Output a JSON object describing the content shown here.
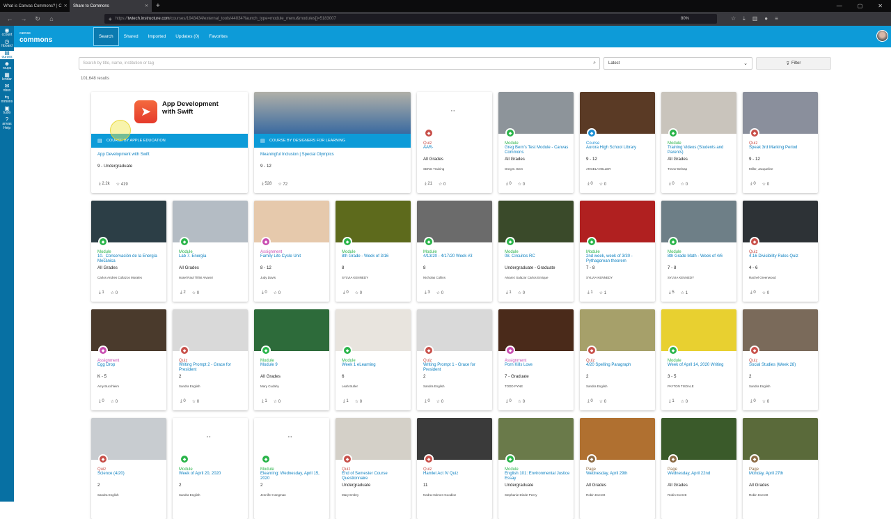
{
  "browser": {
    "tabs": [
      {
        "label": "What is Canvas Commons? | C"
      },
      {
        "label": "Share to Commons"
      }
    ],
    "url_prefix": "https://",
    "url_domain": "twtech.instructure.com",
    "url_rest": "/courses/1943434/external_tools/44034?launch_type=module_menu&modules[]=5183007",
    "zoom": "80%"
  },
  "sidebar": {
    "items": [
      {
        "label": "ccount"
      },
      {
        "label": "hboard"
      },
      {
        "label": "ourses"
      },
      {
        "label": "roups"
      },
      {
        "label": "lendar"
      },
      {
        "label": "nbox"
      },
      {
        "label": "mmons"
      },
      {
        "label": "tudio"
      },
      {
        "label": "anvas\nHelp"
      }
    ]
  },
  "header": {
    "logo_small": "canvas",
    "logo_large": "commons",
    "nav": [
      {
        "label": "Search"
      },
      {
        "label": "Shared"
      },
      {
        "label": "Imported"
      },
      {
        "label": "Updates (0)"
      },
      {
        "label": "Favorites"
      }
    ]
  },
  "search": {
    "placeholder": "Search by title, name, institution or tag"
  },
  "sort": {
    "value": "Latest"
  },
  "filter": {
    "label": "Filter"
  },
  "results": "101,648 results",
  "featured": [
    {
      "banner": "COURSE BY APPLE EDUCATION",
      "title": "App Development with Swift",
      "grade": "9 - Undergraduate",
      "downloads": "2.2k",
      "favorites": "419",
      "app_title": "App Development with Swift"
    },
    {
      "banner": "COURSE BY DESIGNERS FOR LEARNING",
      "title": "Meaningful Inclusion | Special Olympics",
      "grade": "9 - 12",
      "downloads": "528",
      "favorites": "72"
    }
  ],
  "cards": [
    {
      "type": "Quiz",
      "title": "AAR-",
      "grade": "All Grades",
      "author": "SDNG Training",
      "downloads": "21",
      "favorites": "0",
      "img": "loading"
    },
    {
      "type": "Module",
      "title": "Greg Bern's Test Module - Canvas Commons",
      "grade": "All Grades",
      "author": "Greg E. Bern",
      "downloads": "0",
      "favorites": "0",
      "img": "#8d949a"
    },
    {
      "type": "Course",
      "title": "Aurora High School Library",
      "grade": "9 - 12",
      "author": "ANGELA MILLER",
      "downloads": "0",
      "favorites": "0",
      "img": "#5a3a25"
    },
    {
      "type": "Module",
      "title": "Training Videos (Students and Parents)",
      "grade": "All Grades",
      "author": "Trevor Belnap",
      "downloads": "0",
      "favorites": "0",
      "img": "#c9c4bc"
    },
    {
      "type": "Quiz",
      "title": "Speak 3rd Marking Period",
      "grade": "9 - 12",
      "author": "Miller, Jacqueline",
      "downloads": "0",
      "favorites": "0",
      "img": "#8a8f9c"
    },
    {
      "type": "Module",
      "title": "10._Conservación de la Energía Mecánica",
      "grade": "All Grades",
      "author": "Carlos Andres Collazos Morales",
      "downloads": "1",
      "favorites": "0",
      "img": "#2c3e46"
    },
    {
      "type": "Module",
      "title": "Lab 7. Energía",
      "grade": "All Grades",
      "author": "Israel Raul Tiñini Alvarez",
      "downloads": "2",
      "favorites": "0",
      "img": "#b4bcc4"
    },
    {
      "type": "Assignment",
      "title": "Family Life Cycle Unit",
      "grade": "8 - 12",
      "author": "Judy Davis",
      "downloads": "0",
      "favorites": "0",
      "img": "#e6c9ac"
    },
    {
      "type": "Module",
      "title": "8th Grade - Week of 3/16",
      "grade": "8",
      "author": "SYLVIA KENNEDY",
      "downloads": "0",
      "favorites": "0",
      "img": "#5d6a1c"
    },
    {
      "type": "Module",
      "title": "4/13/20 - 4/17/20 Week #3",
      "grade": "8",
      "author": "Nicholas Collins",
      "downloads": "3",
      "favorites": "0",
      "img": "#6b6b6b"
    },
    {
      "type": "Module",
      "title": "08. Circuitos RC",
      "grade": "Undergraduate - Graduate",
      "author": "Alvarez Salazar Carlos Enrique",
      "downloads": "1",
      "favorites": "0",
      "img": "#3a4a2a"
    },
    {
      "type": "Module",
      "title": "2nd week, week of 3/30 - Pythagorean theorem",
      "grade": "7 - 8",
      "author": "SYLVIA KENNEDY",
      "downloads": "1",
      "favorites": "1",
      "img": "#b02020"
    },
    {
      "type": "Module",
      "title": "8th Grade Math - Week of 4/6",
      "grade": "7 - 8",
      "author": "SYLVIA KENNEDY",
      "downloads": "5",
      "favorites": "1",
      "img": "#6e7f87"
    },
    {
      "type": "Quiz",
      "title": "4.16 Divisibility Rules Quiz",
      "grade": "4 - 6",
      "author": "Rachel Greenwood",
      "downloads": "0",
      "favorites": "0",
      "img": "#2d3236"
    },
    {
      "type": "Assignment",
      "title": "Egg Drop",
      "grade": "K - 5",
      "author": "Amy Bucchleim",
      "downloads": "0",
      "favorites": "0",
      "img": "#4a3a2c"
    },
    {
      "type": "Quiz",
      "title": "Writing Prompt 2 - Grace for President",
      "grade": "2",
      "author": "Sandra English",
      "downloads": "0",
      "favorites": "0",
      "img": "#d9d9d9"
    },
    {
      "type": "Module",
      "title": "Module 9",
      "grade": "All Grades",
      "author": "Mary Cudahy",
      "downloads": "1",
      "favorites": "0",
      "img": "#2d6b3a"
    },
    {
      "type": "Module",
      "title": "Week 1 eLearning",
      "grade": "6",
      "author": "Leah Butler",
      "downloads": "1",
      "favorites": "0",
      "img": "#e8e4de"
    },
    {
      "type": "Quiz",
      "title": "Writing Prompt 1 - Grace for President",
      "grade": "2",
      "author": "Sandra English",
      "downloads": "0",
      "favorites": "0",
      "img": "#d9d9d9"
    },
    {
      "type": "Assignment",
      "title": "Porn Kills Love",
      "grade": "7 - Graduate",
      "author": "TODD PYNE",
      "downloads": "0",
      "favorites": "0",
      "img": "#4a2a1a"
    },
    {
      "type": "Quiz",
      "title": "4/20 Spelling Paragraph",
      "grade": "2",
      "author": "Sandra English",
      "downloads": "0",
      "favorites": "0",
      "img": "#a6a06a"
    },
    {
      "type": "Module",
      "title": "Week of April 14, 2020 Writing",
      "grade": "3 - 5",
      "author": "PAYTON TISDALE",
      "downloads": "1",
      "favorites": "0",
      "img": "#e8d030"
    },
    {
      "type": "Quiz",
      "title": "Social Studies (Week 28)",
      "grade": "2",
      "author": "Sandra English",
      "downloads": "0",
      "favorites": "0",
      "img": "#7a6a5a"
    },
    {
      "type": "Quiz",
      "title": "Science (4/20)",
      "grade": "2",
      "author": "Sandra English",
      "downloads": "",
      "favorites": "",
      "img": "#c8ccd0"
    },
    {
      "type": "Module",
      "title": "Week of April 20, 2020",
      "grade": "2",
      "author": "Sandra English",
      "downloads": "",
      "favorites": "",
      "img": "loading"
    },
    {
      "type": "Module",
      "title": "Elearning: Wednesday, April 15, 2020",
      "grade": "2",
      "author": "Jennifer Hangman",
      "downloads": "",
      "favorites": "",
      "img": "loading"
    },
    {
      "type": "Quiz",
      "title": "End of Semester Course Questionnaire",
      "grade": "Undergraduate",
      "author": "Mary Embry",
      "downloads": "",
      "favorites": "",
      "img": "#d4d0c8"
    },
    {
      "type": "Quiz",
      "title": "Hamlet Act IV Quiz",
      "grade": "11",
      "author": "Nedra Holmes-Goodloe",
      "downloads": "",
      "favorites": "",
      "img": "#3a3a3a"
    },
    {
      "type": "Module",
      "title": "English 101: Environmental Justice Essay",
      "grade": "Undergraduate",
      "author": "Stephanie Diede-Peery",
      "downloads": "",
      "favorites": "",
      "img": "#6a7a4a"
    },
    {
      "type": "Page",
      "title": "Wednesday, April 29th",
      "grade": "All Grades",
      "author": "Robin Everett",
      "downloads": "",
      "favorites": "",
      "img": "#b07030"
    },
    {
      "type": "Page",
      "title": "Wednesday, April 22nd",
      "grade": "All Grades",
      "author": "Robin Everett",
      "downloads": "",
      "favorites": "",
      "img": "#3a5a2a"
    },
    {
      "type": "Page",
      "title": "Monday, April 27th",
      "grade": "All Grades",
      "author": "Robin Everett",
      "downloads": "",
      "favorites": "",
      "img": "#5a6a3a"
    }
  ]
}
